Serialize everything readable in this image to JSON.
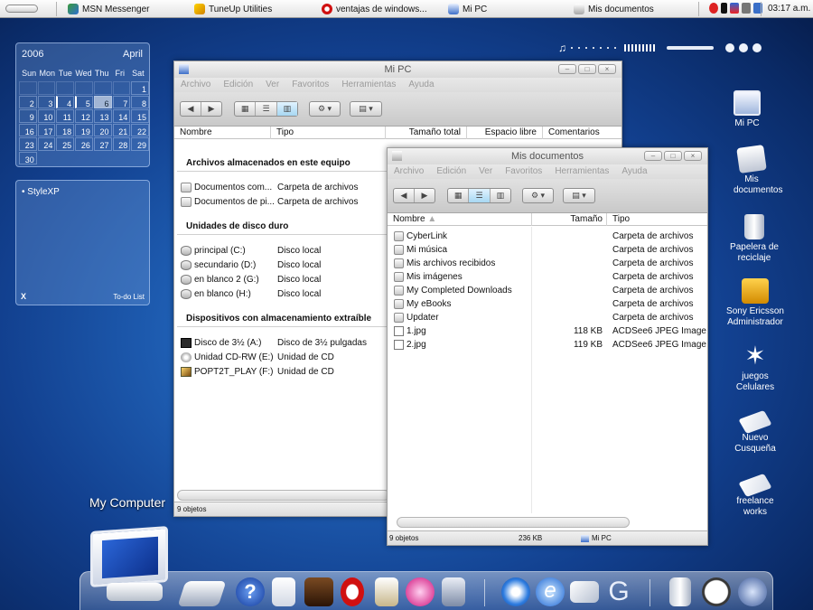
{
  "taskbar": {
    "tasks": [
      {
        "label": "MSN Messenger",
        "icon": "msn-icon"
      },
      {
        "label": "TuneUp Utilities",
        "icon": "tuneup-icon"
      },
      {
        "label": "ventajas de windows...",
        "icon": "opera-icon"
      },
      {
        "label": "Mi PC",
        "icon": "computer-icon"
      },
      {
        "label": "Mis documentos",
        "icon": "documents-icon"
      }
    ],
    "clock": "03:17 a.m."
  },
  "calendar": {
    "year": "2006",
    "month": "April",
    "weekdays": [
      "Sun",
      "Mon",
      "Tue",
      "Wed",
      "Thu",
      "Fri",
      "Sat"
    ],
    "days": [
      "",
      "",
      "",
      "",
      "",
      "",
      "1",
      "2",
      "3",
      "4",
      "5",
      "6",
      "7",
      "8",
      "9",
      "10",
      "11",
      "12",
      "13",
      "14",
      "15",
      "16",
      "17",
      "18",
      "19",
      "20",
      "21",
      "22",
      "23",
      "24",
      "25",
      "26",
      "27",
      "28",
      "29",
      "30"
    ],
    "today": "6",
    "marked": [
      "4",
      "5"
    ]
  },
  "todo": {
    "items": [
      "StyleXP"
    ],
    "close": "X",
    "link": "To-do List"
  },
  "mipc": {
    "title": "Mi PC",
    "menu": [
      "Archivo",
      "Edición",
      "Ver",
      "Favoritos",
      "Herramientas",
      "Ayuda"
    ],
    "columns": [
      "Nombre",
      "Tipo",
      "Tamaño total",
      "Espacio libre",
      "Comentarios"
    ],
    "groups": [
      {
        "heading": "Archivos almacenados en este equipo",
        "items": [
          {
            "name": "Documentos com...",
            "type": "Carpeta de archivos",
            "icon": "folder-icon"
          },
          {
            "name": "Documentos de pi...",
            "type": "Carpeta de archivos",
            "icon": "folder-icon"
          }
        ]
      },
      {
        "heading": "Unidades de disco duro",
        "items": [
          {
            "name": "principal (C:)",
            "type": "Disco local",
            "icon": "hard-drive-icon"
          },
          {
            "name": "secundario (D:)",
            "type": "Disco local",
            "icon": "hard-drive-icon"
          },
          {
            "name": "en blanco 2 (G:)",
            "type": "Disco local",
            "icon": "hard-drive-icon"
          },
          {
            "name": "en blanco (H:)",
            "type": "Disco local",
            "icon": "hard-drive-icon"
          }
        ]
      },
      {
        "heading": "Dispositivos con almacenamiento extraíble",
        "items": [
          {
            "name": "Disco de 3½ (A:)",
            "type": "Disco de 3½ pulgadas",
            "icon": "floppy-icon"
          },
          {
            "name": "Unidad CD-RW (E:)",
            "type": "Unidad de CD",
            "icon": "cd-drive-icon"
          },
          {
            "name": "POPT2T_PLAY (F:)",
            "type": "Unidad de CD",
            "icon": "cd-picture-icon"
          }
        ]
      }
    ],
    "status": "9 objetos"
  },
  "misdocs": {
    "title": "Mis documentos",
    "menu": [
      "Archivo",
      "Edición",
      "Ver",
      "Favoritos",
      "Herramientas",
      "Ayuda"
    ],
    "columns": [
      "Nombre",
      "Tamaño",
      "Tipo"
    ],
    "rows": [
      {
        "name": "CyberLink",
        "size": "",
        "type": "Carpeta de archivos",
        "icon": "folder-icon"
      },
      {
        "name": "Mi música",
        "size": "",
        "type": "Carpeta de archivos",
        "icon": "folder-icon"
      },
      {
        "name": "Mis archivos recibidos",
        "size": "",
        "type": "Carpeta de archivos",
        "icon": "folder-icon"
      },
      {
        "name": "Mis imágenes",
        "size": "",
        "type": "Carpeta de archivos",
        "icon": "folder-icon"
      },
      {
        "name": "My Completed Downloads",
        "size": "",
        "type": "Carpeta de archivos",
        "icon": "folder-icon"
      },
      {
        "name": "My eBooks",
        "size": "",
        "type": "Carpeta de archivos",
        "icon": "folder-icon"
      },
      {
        "name": "Updater",
        "size": "",
        "type": "Carpeta de archivos",
        "icon": "folder-icon"
      },
      {
        "name": "1.jpg",
        "size": "118 KB",
        "type": "ACDSee6 JPEG Image",
        "icon": "jpeg-file-icon"
      },
      {
        "name": "2.jpg",
        "size": "119 KB",
        "type": "ACDSee6 JPEG Image",
        "icon": "jpeg-file-icon"
      }
    ],
    "status": {
      "count": "9 objetos",
      "size": "236 KB",
      "location": "Mi PC"
    }
  },
  "desktop_icons": [
    {
      "label": "Mi PC",
      "icon": "computer-icon"
    },
    {
      "label": "Mis documentos",
      "icon": "documents-icon"
    },
    {
      "label": "Papelera de reciclaje",
      "icon": "recycle-bin-icon"
    },
    {
      "label": "Sony Ericsson Administrador",
      "icon": "phone-icon"
    },
    {
      "label": "juegos Celulares",
      "icon": "star-icon"
    },
    {
      "label": "Nuevo Cusqueña",
      "icon": "note-icon"
    },
    {
      "label": "freelance works",
      "icon": "note-icon"
    }
  ],
  "dock": {
    "label": "My Computer",
    "items": [
      "my-computer-icon",
      "search-icon",
      "help-icon",
      "document-icon",
      "game-icon",
      "opera-icon",
      "notepad-icon",
      "flower-icon",
      "recycle-icon",
      "media-player-icon",
      "internet-explorer-icon",
      "mail-icon",
      "google-icon",
      "trash-icon",
      "clock-icon",
      "settings-icon"
    ]
  },
  "colors": {
    "desktop_top": "#1f5fb4",
    "desktop_dark": "#061c4a",
    "window_chrome": "#dcdcdc",
    "selected_view": "#a7d7f2"
  }
}
